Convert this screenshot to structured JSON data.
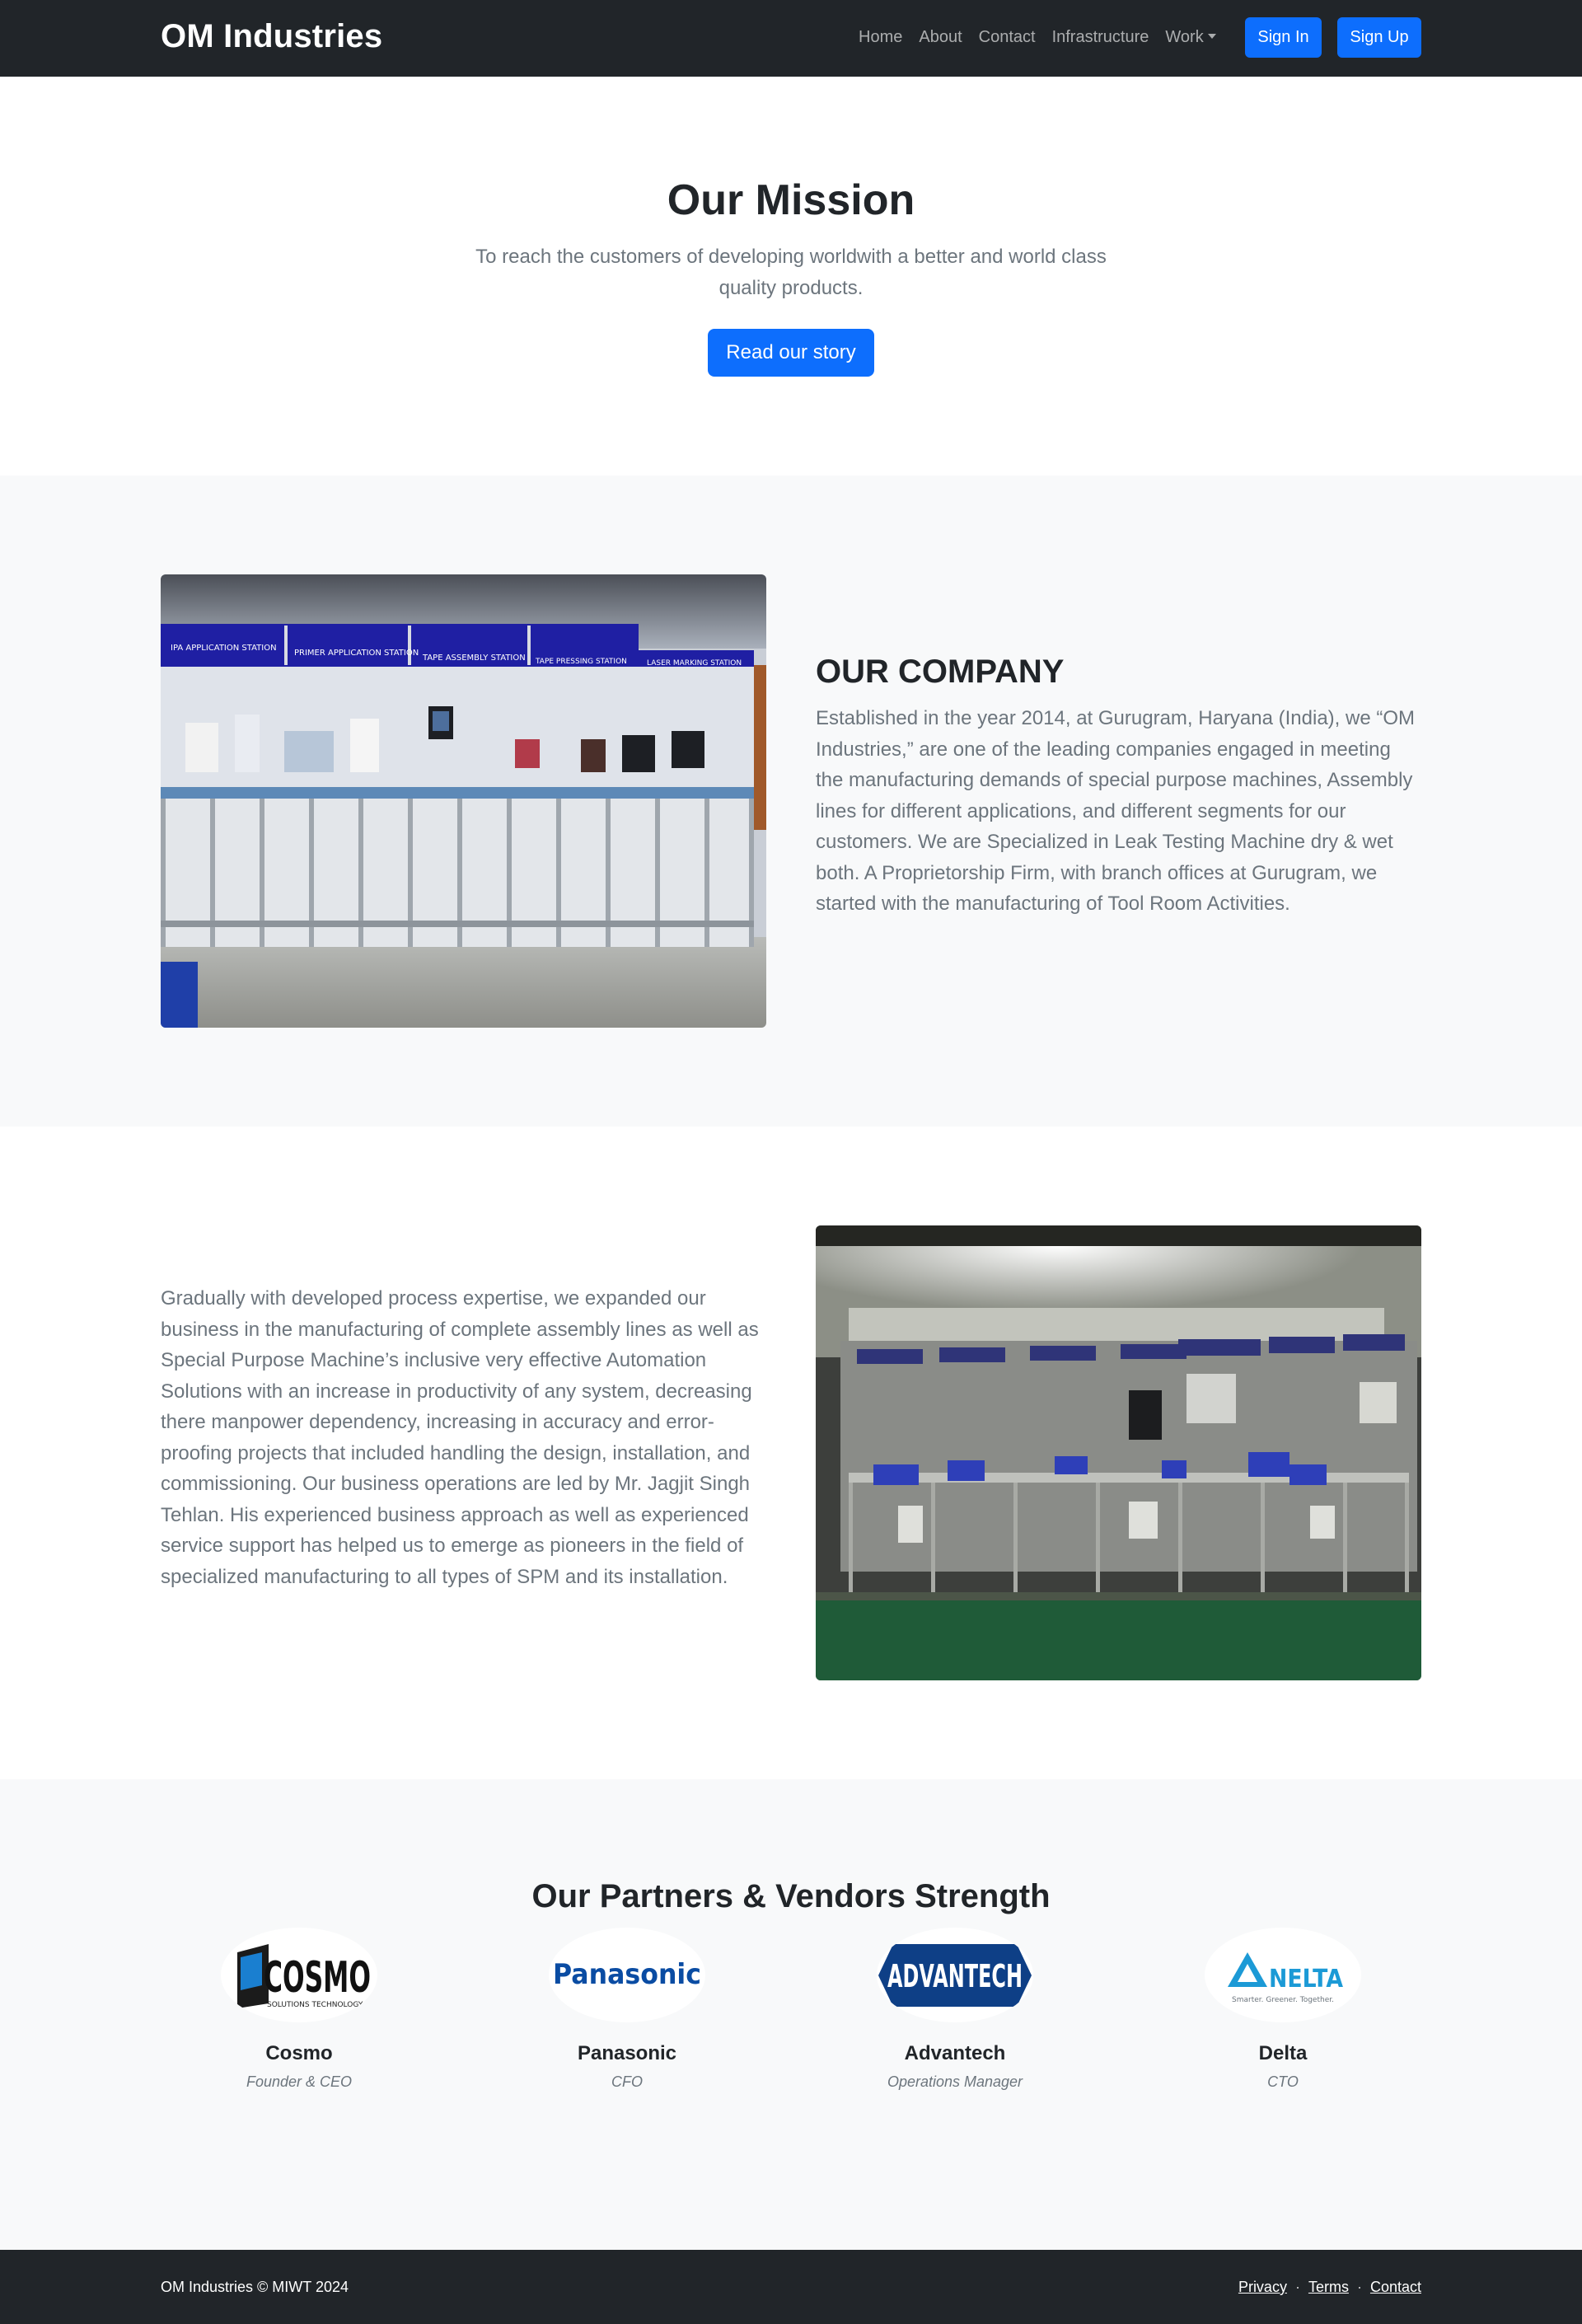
{
  "navbar": {
    "brand": "OM Industries",
    "links": [
      "Home",
      "About",
      "Contact",
      "Infrastructure",
      "Work"
    ],
    "signin": "Sign In",
    "signup": "Sign Up"
  },
  "mission": {
    "title": "Our Mission",
    "text": "To reach the customers of developing worldwith a better and world class quality products.",
    "button": "Read our story"
  },
  "company": {
    "title": "OUR COMPANY",
    "text": "Established in the year 2014, at Gurugram, Haryana (India), we “OM Industries,” are one of the leading companies engaged in meeting the manufacturing demands of special purpose machines, Assembly lines for different applications, and different segments for our customers. We are Specialized in Leak Testing Machine dry & wet both. A Proprietorship Firm, with branch offices at Gurugram, we started with the manufacturing of Tool Room Activities.",
    "image_labels": [
      "IPA APPLICATION STATION",
      "PRIMER APPLICATION STATION",
      "TAPE ASSEMBLY STATION",
      "TAPE PRESSING STATION",
      "LASER MARKING STATION"
    ]
  },
  "expansion": {
    "text": "Gradually with developed process expertise, we expanded our business in the manufacturing of complete assembly lines as well as Special Purpose Machine’s inclusive very effective Automation Solutions with an increase in productivity of any system, decreasing there manpower dependency, increasing in accuracy and error-proofing projects that included handling the design, installation, and commissioning. Our business operations are led by Mr. Jagjit Singh Tehlan. His experienced business approach as well as experienced service support has helped us to emerge as pioneers in the field of specialized manufacturing to all types of SPM and its installation."
  },
  "partners": {
    "title": "Our Partners & Vendors Strength",
    "items": [
      {
        "name": "Cosmo",
        "role": "Founder & CEO",
        "logo_text": "COSMO",
        "logo_sub": "SOLUTIONS TECHNOLOGY"
      },
      {
        "name": "Panasonic",
        "role": "CFO",
        "logo_text": "Panasonic"
      },
      {
        "name": "Advantech",
        "role": "Operations Manager",
        "logo_text": "ADVANTECH"
      },
      {
        "name": "Delta",
        "role": "CTO",
        "logo_text": "NELTA",
        "logo_sub": "Smarter. Greener. Together."
      }
    ]
  },
  "footer": {
    "copyright": "OM Industries © MIWT 2024",
    "links": [
      "Privacy",
      "Terms",
      "Contact"
    ],
    "separator": "·"
  },
  "colors": {
    "navbar_bg": "#212529",
    "primary": "#0d6efd",
    "section_alt_bg": "#f8f9fa",
    "muted_text": "#6c757d"
  }
}
